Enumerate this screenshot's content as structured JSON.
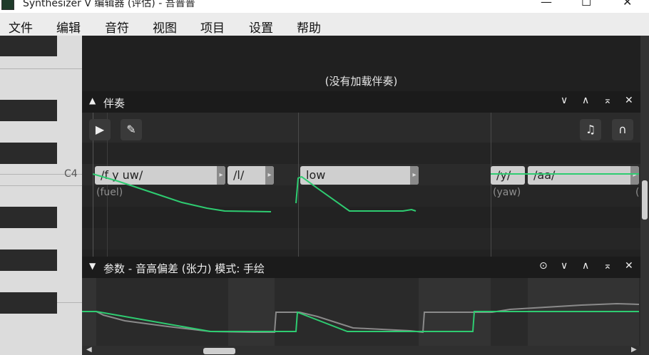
{
  "window": {
    "title": "Synthesizer V 编辑器 (评估) - 吾普普",
    "minimize": "—",
    "maximize": "☐",
    "close": "✕"
  },
  "menu": [
    "文件",
    "编辑",
    "音符",
    "视图",
    "项目",
    "设置",
    "帮助"
  ],
  "piano": {
    "c4_label": "C4"
  },
  "accompaniment": {
    "message": "(没有加载伴奏)",
    "header": "伴奏",
    "controls": {
      "collapse": "▲",
      "down": "∨",
      "up": "∧",
      "maximize": "⌅",
      "close": "✕"
    }
  },
  "tools": {
    "play": "▶",
    "pencil": "✎",
    "note_icon": "♫",
    "headphones": "∩"
  },
  "notes": [
    {
      "lyric": "/f y uw/",
      "orig": "(fuel)"
    },
    {
      "lyric": "/l/"
    },
    {
      "lyric": "low"
    },
    {
      "lyric": "/y/",
      "orig": "(yaw)"
    },
    {
      "lyric": "/aa/",
      "orig": "("
    }
  ],
  "parameters": {
    "collapse": "▼",
    "label": "参数 - 音高偏差 (张力) 模式: 手绘",
    "controls": {
      "target": "⊙",
      "down": "∨",
      "up": "∧",
      "maximize": "⌅",
      "close": "✕"
    }
  },
  "colors": {
    "pitch_curve": "#2ecc71",
    "note_block": "#cfcfcf",
    "background": "#262626"
  }
}
